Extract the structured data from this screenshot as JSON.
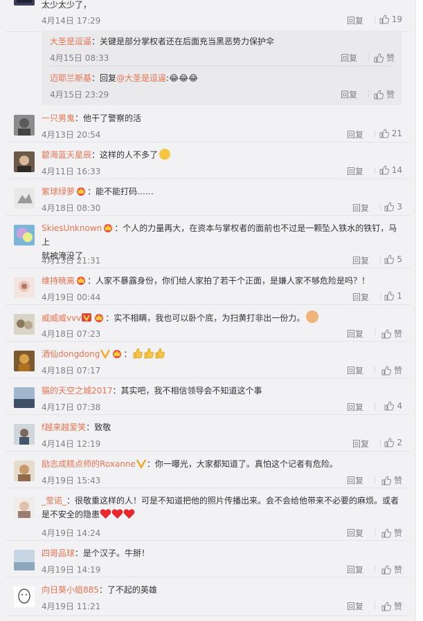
{
  "top": {
    "text": "太少太少了，",
    "time": "4月14日 17:29",
    "reply": "回复",
    "likes": "19"
  },
  "subs": [
    {
      "user": "大圣是逗逼",
      "text": "：关键是部分掌权者还在后面充当黑恶势力保护伞",
      "time": "4月15日 08:33",
      "reply": "回复",
      "likes": "赞"
    },
    {
      "user": "迈耶兰斯基",
      "prefix": "：回复",
      "mention": "@大圣是逗逼",
      "text": ":😂😂😂",
      "time": "4月15日 23:29",
      "reply": "回复",
      "likes": "赞"
    }
  ],
  "comments": [
    {
      "user": "一只男鬼",
      "text": "：他干了警察的活",
      "time": "4月13日 20:54",
      "reply": "回复",
      "likes": "21"
    },
    {
      "user": "碧海蓝天星辰",
      "text": "：这样的人不多了",
      "time": "4月11日 16:33",
      "reply": "回复",
      "likes": "14"
    },
    {
      "user": "紫球绿萝",
      "text": "：能不能打码……",
      "time": "4月18日 08:30",
      "reply": "回复",
      "likes": "3"
    },
    {
      "user": "SkiesUnknown",
      "text": "：个人的力量再大，在资本与掌权者的面前也不过是一颗坠入铁水的铁钉，马上",
      "text2": "就被淹没了",
      "time": "4月13日 21:31",
      "reply": "回复",
      "likes": "5"
    },
    {
      "user": "维持暁离",
      "text": "：人家不暴露身份，你们给人家拍了若干个正面，是嫌人家不够危险是吗？！",
      "time": "4月19日 00:44",
      "reply": "回复",
      "likes": "1"
    },
    {
      "user": "威威威vvv",
      "text": "：实不相瞒，我也可以卧个底，为扫黄打非出一份力。",
      "time": "4月18日 07:23",
      "reply": "回复",
      "likes": "赞"
    },
    {
      "user": "酒仙dongdong",
      "text": "：",
      "time": "4月18日 07:17",
      "reply": "回复",
      "likes": "赞"
    },
    {
      "user": "猫的天空之城2017",
      "text": "：其实吧，我不相信领导会不知道这个事",
      "time": "4月17日 07:38",
      "reply": "回复",
      "likes": "4"
    },
    {
      "user": "f越来越爱笑",
      "text": "：致敬",
      "time": "4月14日 12:19",
      "reply": "回复",
      "likes": "2"
    },
    {
      "user": "励志成糕点师的Roxanne",
      "text": "：你一曝光，大家都知道了。真怕这个记者有危险。",
      "time": "4月19日 15:43",
      "reply": "回复",
      "likes": "赞"
    },
    {
      "user": "_莹诺_",
      "text": "：很敬重这样的人！可是不知道把他的照片传播出来。会不会给他带来不必要的麻烦。或者",
      "text2": "是不安全的隐患",
      "time": "4月19日 14:24",
      "reply": "回复",
      "likes": "赞"
    },
    {
      "user": "四哥品球",
      "text": "：是个汉子。牛掰！",
      "time": "4月19日 14:19",
      "reply": "回复",
      "likes": "赞"
    },
    {
      "user": "向日葵小姐885",
      "text": "：了不起的英雄",
      "time": "4月19日 11:21",
      "reply": "回复",
      "likes": "赞"
    }
  ],
  "colors": {
    "username": "#eb7350",
    "meta": "#808080",
    "text": "#333333",
    "subBg": "#eaeaec"
  }
}
